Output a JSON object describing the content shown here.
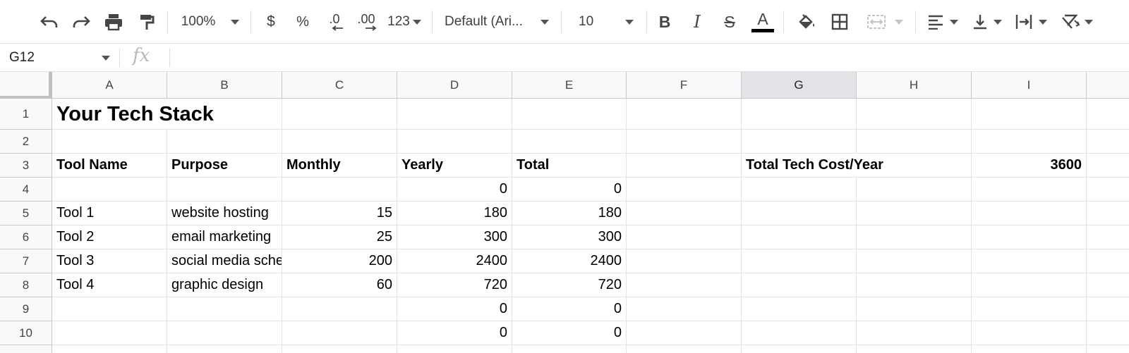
{
  "toolbar": {
    "zoom": "100%",
    "currency_symbol": "$",
    "percent_symbol": "%",
    "decrease_decimal_label": ".0",
    "increase_decimal_label": ".00",
    "more_formats_label": "123",
    "font_family": "Default (Ari...",
    "font_size": "10",
    "bold_label": "B",
    "italic_label": "I",
    "strikethrough_label": "S",
    "text_color_label": "A"
  },
  "formula_bar": {
    "name_box": "G12",
    "fx_label": "fx",
    "formula": ""
  },
  "columns": [
    "A",
    "B",
    "C",
    "D",
    "E",
    "F",
    "G",
    "H",
    "I"
  ],
  "selected_column": "G",
  "rows": [
    "1",
    "2",
    "3",
    "4",
    "5",
    "6",
    "7",
    "8",
    "9",
    "10"
  ],
  "sheet": {
    "title": "Your Tech Stack",
    "headers": {
      "tool_name": "Tool Name",
      "purpose": "Purpose",
      "monthly": "Monthly",
      "yearly": "Yearly",
      "total": "Total"
    },
    "summary": {
      "label": "Total Tech Cost/Year",
      "value": "3600"
    },
    "data_rows": [
      {
        "row": "4",
        "tool": "",
        "purpose": "",
        "monthly": "",
        "yearly": "0",
        "total": "0"
      },
      {
        "row": "5",
        "tool": "Tool 1",
        "purpose": "website hosting",
        "monthly": "15",
        "yearly": "180",
        "total": "180"
      },
      {
        "row": "6",
        "tool": "Tool 2",
        "purpose": "email marketing",
        "monthly": "25",
        "yearly": "300",
        "total": "300"
      },
      {
        "row": "7",
        "tool": "Tool 3",
        "purpose": "social media scheduling",
        "monthly": "200",
        "yearly": "2400",
        "total": "2400"
      },
      {
        "row": "8",
        "tool": "Tool 4",
        "purpose": "graphic design",
        "monthly": "60",
        "yearly": "720",
        "total": "720"
      },
      {
        "row": "9",
        "tool": "",
        "purpose": "",
        "monthly": "",
        "yearly": "0",
        "total": "0"
      },
      {
        "row": "10",
        "tool": "",
        "purpose": "",
        "monthly": "",
        "yearly": "0",
        "total": "0"
      }
    ]
  },
  "colors": {
    "text_color_bar": "#000000",
    "header_bg": "#f8f9fa",
    "selected_header_bg": "#e1e3e6",
    "grid_line": "#e2e2e2"
  }
}
